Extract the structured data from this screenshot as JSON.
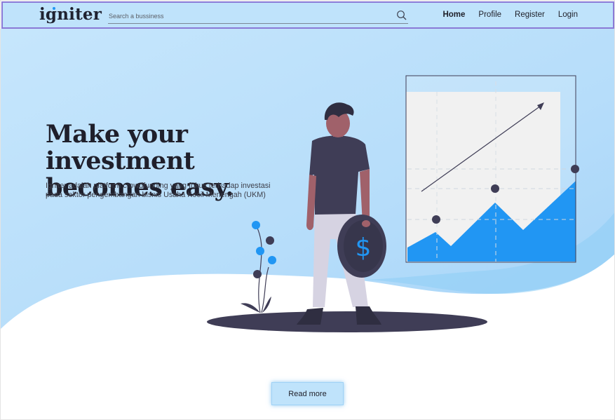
{
  "brand": {
    "name": "igniter"
  },
  "search": {
    "placeholder": "Search a bussiness",
    "value": ""
  },
  "nav": {
    "items": [
      {
        "label": "Home",
        "active": true
      },
      {
        "label": "Profile",
        "active": false
      },
      {
        "label": "Register",
        "active": false
      },
      {
        "label": "Login",
        "active": false
      }
    ]
  },
  "hero": {
    "title_line1": "Make your investment",
    "title_line2": "becomes easy.",
    "description": "Igniter adalah platform crowdfunding yang fokus terhadap investasi pada sektor pengembangan bisnis Usaha Kecil Menengah (UKM)",
    "cta_label": "Read more"
  },
  "icons": {
    "search": "search-icon",
    "coin": "dollar-coin-icon",
    "chart": "growth-chart-icon"
  },
  "colors": {
    "nav_bg": "#bfe3fb",
    "nav_border": "#8a7ad6",
    "hero_sky": "#bfe3fb",
    "accent_blue": "#2196f3",
    "dark": "#3f3d56"
  }
}
